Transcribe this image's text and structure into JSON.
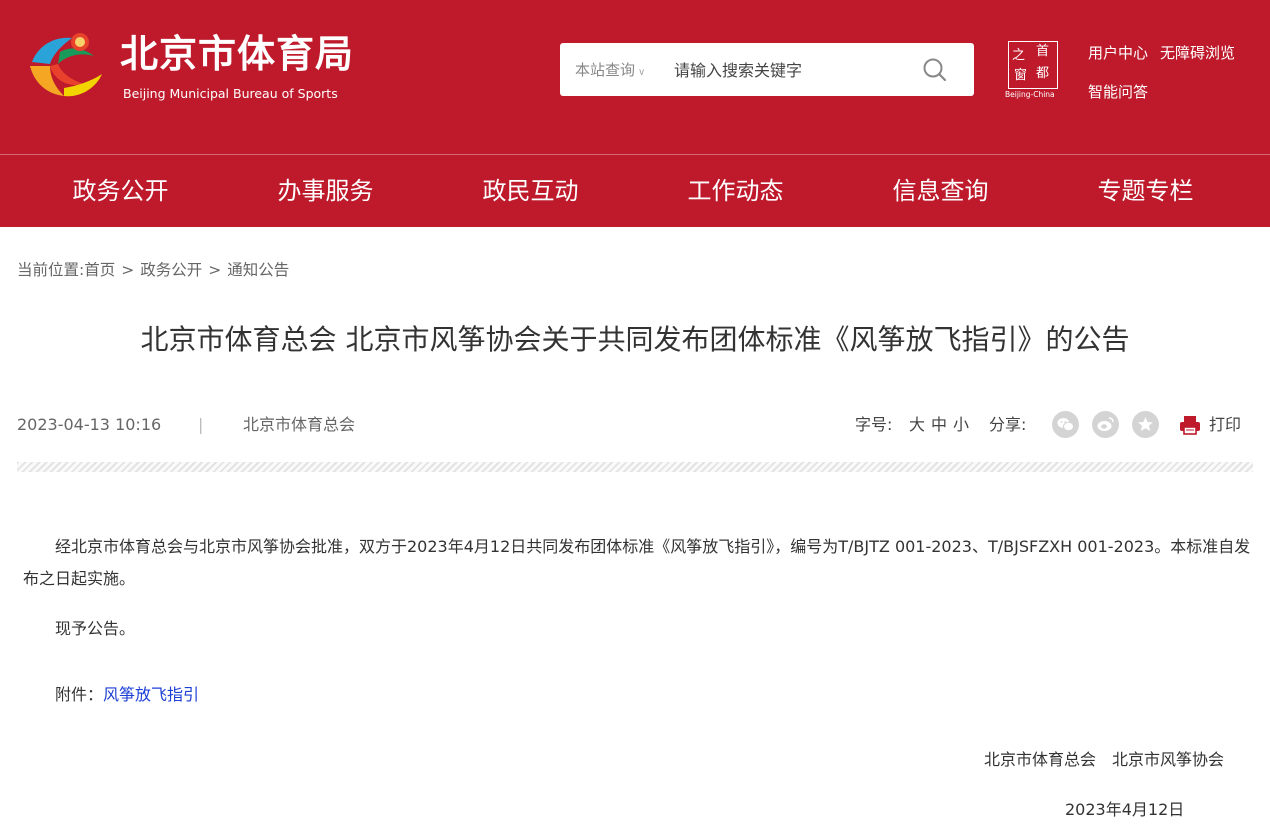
{
  "header": {
    "logo_cn": "北京市体育局",
    "logo_en": "Beijing Municipal Bureau of Sports",
    "search": {
      "scope": "本站查询",
      "placeholder": "请输入搜索关键字"
    },
    "capital_logo": {
      "chars": [
        "之",
        "首",
        "窗",
        "都"
      ],
      "sub": "Beijing-China"
    },
    "links": {
      "user_center": "用户中心",
      "accessibility": "无障碍浏览",
      "smart_qa": "智能问答"
    },
    "colors": {
      "brand_red": "#be1a2c"
    }
  },
  "nav": {
    "items": [
      "政务公开",
      "办事服务",
      "政民互动",
      "工作动态",
      "信息查询",
      "专题专栏"
    ]
  },
  "breadcrumb": {
    "prefix": "当前位置:",
    "items": [
      "首页",
      "政务公开",
      "通知公告"
    ],
    "separator": ">"
  },
  "article": {
    "title": "北京市体育总会 北京市风筝协会关于共同发布团体标准《风筝放飞指引》的公告",
    "date": "2023-04-13 10:16",
    "divider": "|",
    "source": "北京市体育总会",
    "font_size_label": "字号:",
    "font_sizes": [
      "大",
      "中",
      "小"
    ],
    "share_label": "分享:",
    "share_icons": [
      "wechat-icon",
      "weibo-icon",
      "favorite-icon"
    ],
    "print_label": "打印",
    "para1": "经北京市体育总会与北京市风筝协会批准，双方于2023年4月12日共同发布团体标准《风筝放飞指引》，编号为T/BJTZ 001-2023、T/BJSFZXH 001-2023。本标准自发布之日起实施。",
    "para2": "现予公告。",
    "attachment_label": "附件：",
    "attachment_link": "风筝放飞指引",
    "signatories": "北京市体育总会　北京市风筝协会",
    "sign_date": "2023年4月12日"
  }
}
